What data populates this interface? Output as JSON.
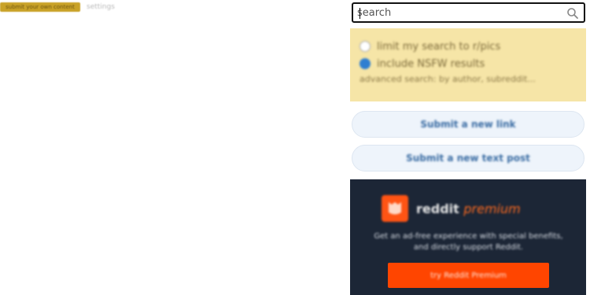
{
  "header": {
    "tagline": "submit your own content",
    "secondary_link": "settings"
  },
  "search": {
    "placeholder": "search"
  },
  "search_options": {
    "option_1": "limit my search to r/pics",
    "option_2": "include NSFW results",
    "advanced_link": "advanced search: by author, subreddit..."
  },
  "buttons": {
    "submit_link": "Submit a new link",
    "submit_text": "Submit a new text post"
  },
  "premium": {
    "brand": "reddit",
    "brand_accent": "premium",
    "description": "Get an ad-free experience with special benefits, and directly support Reddit.",
    "cta": "try Reddit Premium"
  },
  "colors": {
    "premium_orange": "#ff4500",
    "search_options_bg": "#f6e5a7",
    "premium_bg": "#1c2636"
  }
}
